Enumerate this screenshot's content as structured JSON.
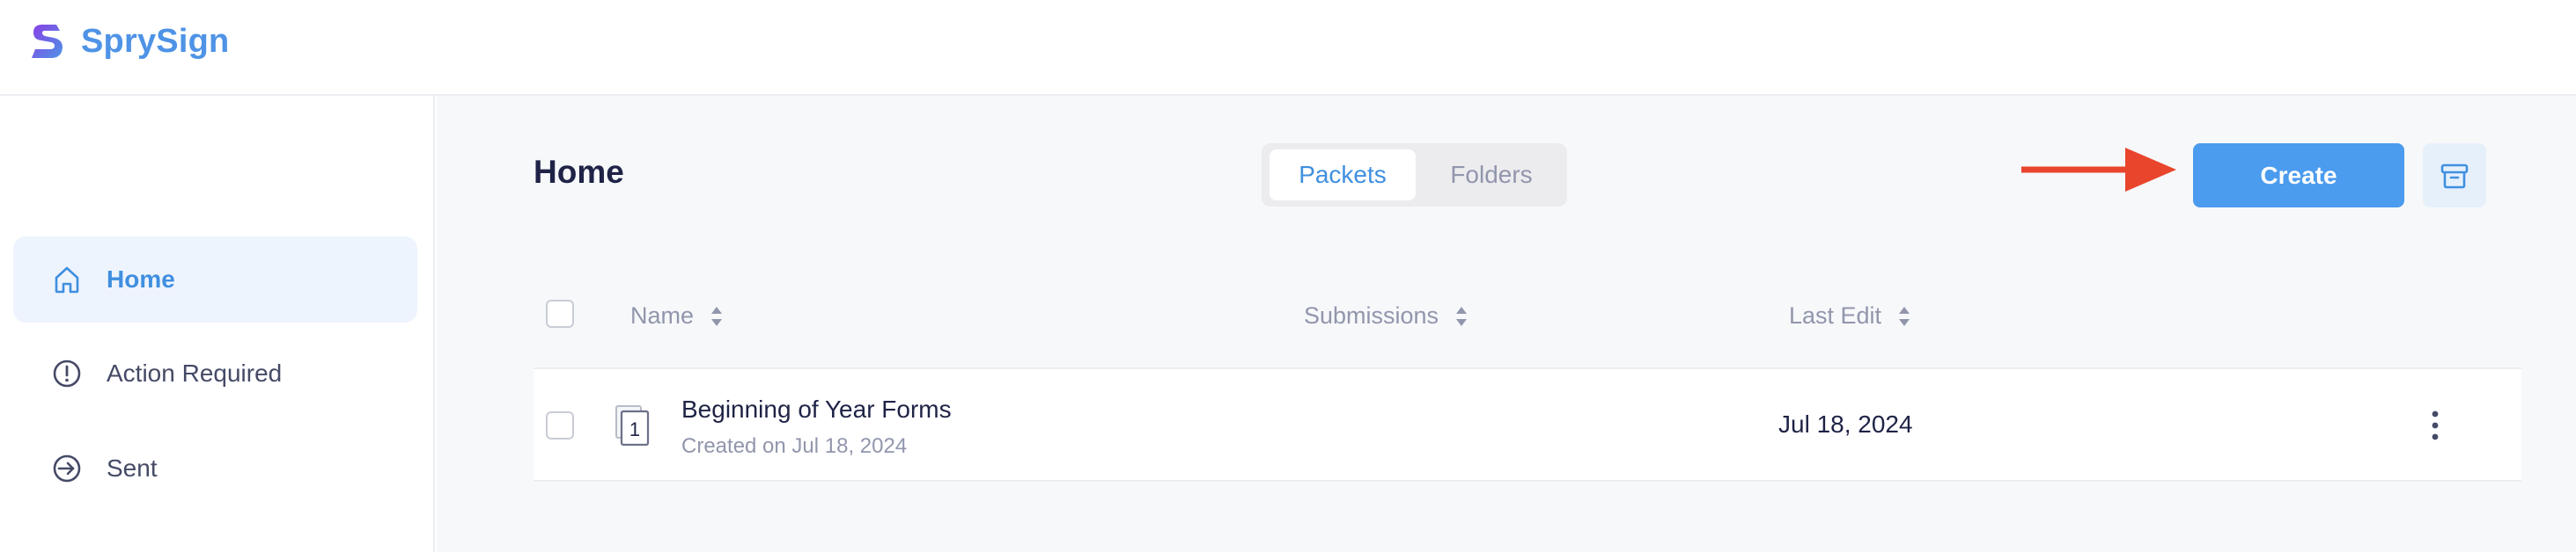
{
  "app": {
    "name": "SprySign",
    "brand_color": "#4e93e6",
    "accent_gradient": [
      "#7b3fe4",
      "#4e93e6"
    ]
  },
  "sidebar": {
    "items": [
      {
        "label": "Home",
        "icon": "home-icon",
        "active": true
      },
      {
        "label": "Action Required",
        "icon": "alert-circle-icon",
        "active": false
      },
      {
        "label": "Sent",
        "icon": "sent-arrow-circle-icon",
        "active": false
      }
    ]
  },
  "main": {
    "title": "Home",
    "view_toggle": {
      "options": [
        "Packets",
        "Folders"
      ],
      "selected": "Packets"
    },
    "create_label": "Create",
    "archive_icon": "archive-icon",
    "annotation_arrow_color": "#e8452c"
  },
  "table": {
    "columns": [
      "Name",
      "Submissions",
      "Last Edit"
    ],
    "rows": [
      {
        "name": "Beginning of Year Forms",
        "created": "Created on Jul 18, 2024",
        "page_count": "1",
        "submissions": "",
        "last_edit": "Jul 18, 2024"
      }
    ]
  }
}
